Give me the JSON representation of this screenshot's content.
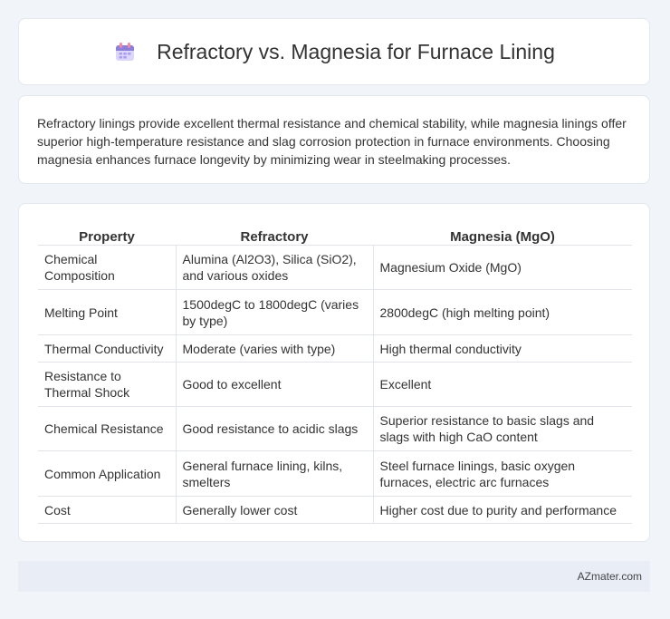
{
  "header": {
    "icon": "calendar-icon",
    "title": "Refractory vs. Magnesia for Furnace Lining"
  },
  "intro": {
    "text": "Refractory linings provide excellent thermal resistance and chemical stability, while magnesia linings offer superior high-temperature resistance and slag corrosion protection in furnace environments. Choosing magnesia enhances furnace longevity by minimizing wear in steelmaking processes."
  },
  "table": {
    "headers": [
      "Property",
      "Refractory",
      "Magnesia (MgO)"
    ],
    "rows": [
      [
        "Chemical Composition",
        "Alumina (Al2O3), Silica (SiO2), and various oxides",
        "Magnesium Oxide (MgO)"
      ],
      [
        "Melting Point",
        "1500degC to 1800degC (varies by type)",
        "2800degC (high melting point)"
      ],
      [
        "Thermal Conductivity",
        "Moderate (varies with type)",
        "High thermal conductivity"
      ],
      [
        "Resistance to Thermal Shock",
        "Good to excellent",
        "Excellent"
      ],
      [
        "Chemical Resistance",
        "Good resistance to acidic slags",
        "Superior resistance to basic slags and slags with high CaO content"
      ],
      [
        "Common Application",
        "General furnace lining, kilns, smelters",
        "Steel furnace linings, basic oxygen furnaces, electric arc furnaces"
      ],
      [
        "Cost",
        "Generally lower cost",
        "Higher cost due to purity and performance"
      ]
    ]
  },
  "footer": {
    "brand": "AZmater.com"
  },
  "colors": {
    "background": "#f1f4f9",
    "card": "#ffffff",
    "footer_bg": "#e8edf6",
    "icon_purple": "#8b7fd8",
    "icon_pink": "#f08aa5"
  }
}
